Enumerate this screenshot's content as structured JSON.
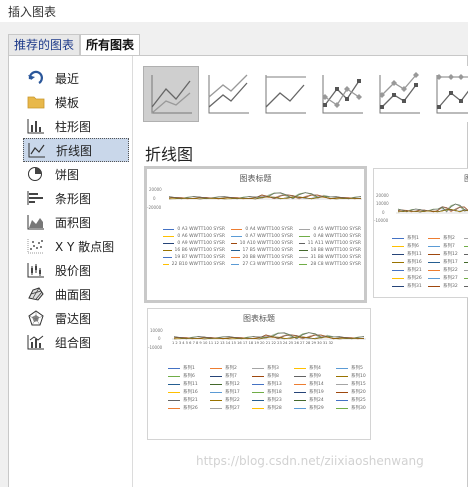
{
  "window": {
    "title": "插入图表"
  },
  "tabs": [
    {
      "label": "推荐的图表",
      "active": true
    },
    {
      "label": "所有图表",
      "active": false
    }
  ],
  "sidebar": {
    "items": [
      {
        "label": "最近",
        "icon": "recent-arrow-icon"
      },
      {
        "label": "模板",
        "icon": "folder-icon"
      },
      {
        "label": "柱形图",
        "icon": "column-chart-icon"
      },
      {
        "label": "折线图",
        "icon": "line-chart-icon",
        "selected": true
      },
      {
        "label": "饼图",
        "icon": "pie-chart-icon"
      },
      {
        "label": "条形图",
        "icon": "bar-chart-icon"
      },
      {
        "label": "面积图",
        "icon": "area-chart-icon"
      },
      {
        "label": "X Y 散点图",
        "icon": "scatter-chart-icon"
      },
      {
        "label": "股价图",
        "icon": "stock-chart-icon"
      },
      {
        "label": "曲面图",
        "icon": "surface-chart-icon"
      },
      {
        "label": "雷达图",
        "icon": "radar-chart-icon"
      },
      {
        "label": "组合图",
        "icon": "combo-chart-icon"
      }
    ]
  },
  "subtypes": [
    {
      "name": "line",
      "selected": true
    },
    {
      "name": "stacked-line"
    },
    {
      "name": "100-stacked-line"
    },
    {
      "name": "line-with-markers"
    },
    {
      "name": "stacked-line-with-markers"
    },
    {
      "name": "100-stacked-line-with-markers"
    }
  ],
  "heading": "折线图",
  "previews": {
    "p1": {
      "title": "图表标题",
      "y_ticks": [
        "20000",
        "0",
        "-20000"
      ],
      "legend": [
        "0 A3 WWTT100 SYSR",
        "0 A4 WWTT100 SYSR",
        "0 A5 WWTT100 SYSR",
        "0 A6 WWTT100 SYSR",
        "0 A7 WWTT100 SYSR",
        "0 A8 WWTT100 SYSR",
        "0 A9 WWTT100 SYSR",
        "10 A10 WWTT100 SYSR",
        "11 A11 WWTT100 SYSR",
        "16 B6 WWTT100 SYSR",
        "17 B5 WWTT100 SYSR",
        "18 B8 WWTT100 SYSR",
        "19 B7 WWTT100 SYSR",
        "20 B8 WWTT100 SYSR",
        "31 B8 WWTT100 SYSR",
        "22 B10 WWTT100 SYSR",
        "27 C3 WWTT100 SYSR",
        "28 C8 WWTT100 SYSR"
      ]
    },
    "p2": {
      "title": "图",
      "y_ticks": [
        "20000",
        "10000",
        "0",
        "-10000"
      ],
      "legend": [
        "系列1",
        "系列2",
        "系列3",
        "系列6",
        "系列7",
        "系列8",
        "系列11",
        "系列12",
        "系列13",
        "系列16",
        "系列17",
        "系列18",
        "系列21",
        "系列22",
        "系列23",
        "系列26",
        "系列27",
        "系列28",
        "系列31",
        "系列32",
        "系列33"
      ]
    },
    "p3": {
      "title": "图表标题",
      "y_ticks": [
        "10000",
        "0",
        "-10000"
      ],
      "x_labels": "1 2 3 4 5 6 7 8 9 10 11 12 13 14 15 16 17 18 19 20 21 22 23 24 25 26 27 28 29 30 31 32",
      "legend": [
        "系列1",
        "系列2",
        "系列3",
        "系列4",
        "系列5",
        "系列6",
        "系列7",
        "系列8",
        "系列9",
        "系列10",
        "系列11",
        "系列12",
        "系列13",
        "系列14",
        "系列15",
        "系列16",
        "系列17",
        "系列18",
        "系列19",
        "系列20",
        "系列21",
        "系列22",
        "系列23",
        "系列24",
        "系列25",
        "系列26",
        "系列27",
        "系列28",
        "系列29",
        "系列30"
      ]
    }
  },
  "series_colors": [
    "#4472c4",
    "#ed7d31",
    "#a5a5a5",
    "#ffc000",
    "#5b9bd5",
    "#70ad47",
    "#264478",
    "#9e480e",
    "#636363",
    "#997300",
    "#255e91",
    "#43682b"
  ],
  "watermark": "https://blog.csdn.net/ziixiaoshenwang"
}
